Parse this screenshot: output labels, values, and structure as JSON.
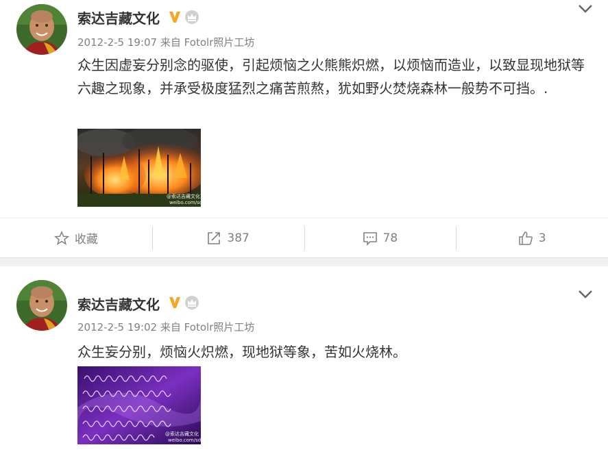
{
  "posts": [
    {
      "author": "索达吉藏文化",
      "time": "2012-2-5 19:07",
      "source_prefix": "来自",
      "source": "Fotolr照片工坊",
      "text": "众生因虚妄分别念的驱使，引起烦恼之火熊熊炽燃，以烦恼而造业，以致显现地狱等六趣之现象，并承受极度猛烈之痛苦煎熬，犹如野火焚烧森林一般势不可挡。.",
      "image_icon": "forest-fire-image",
      "watermark": "@索达吉藏文化",
      "watermark_url": "weibo.com/sdjzwh",
      "actions": {
        "favorite_label": "收藏",
        "repost_count": "387",
        "comment_count": "78",
        "like_count": "3"
      }
    },
    {
      "author": "索达吉藏文化",
      "time": "2012-2-5 19:02",
      "source_prefix": "来自",
      "source": "Fotolr照片工坊",
      "text": "众生妄分别，烦恼火炽燃，现地狱等象，苦如火烧林。",
      "image_icon": "tibetan-script-image",
      "watermark": "@索达吉藏文化",
      "watermark_url": "weibo.com/sdjzwh"
    }
  ],
  "colors": {
    "text": "#333333",
    "meta": "#808080",
    "verified": "#f5a623",
    "divider": "#d9d9d9"
  }
}
